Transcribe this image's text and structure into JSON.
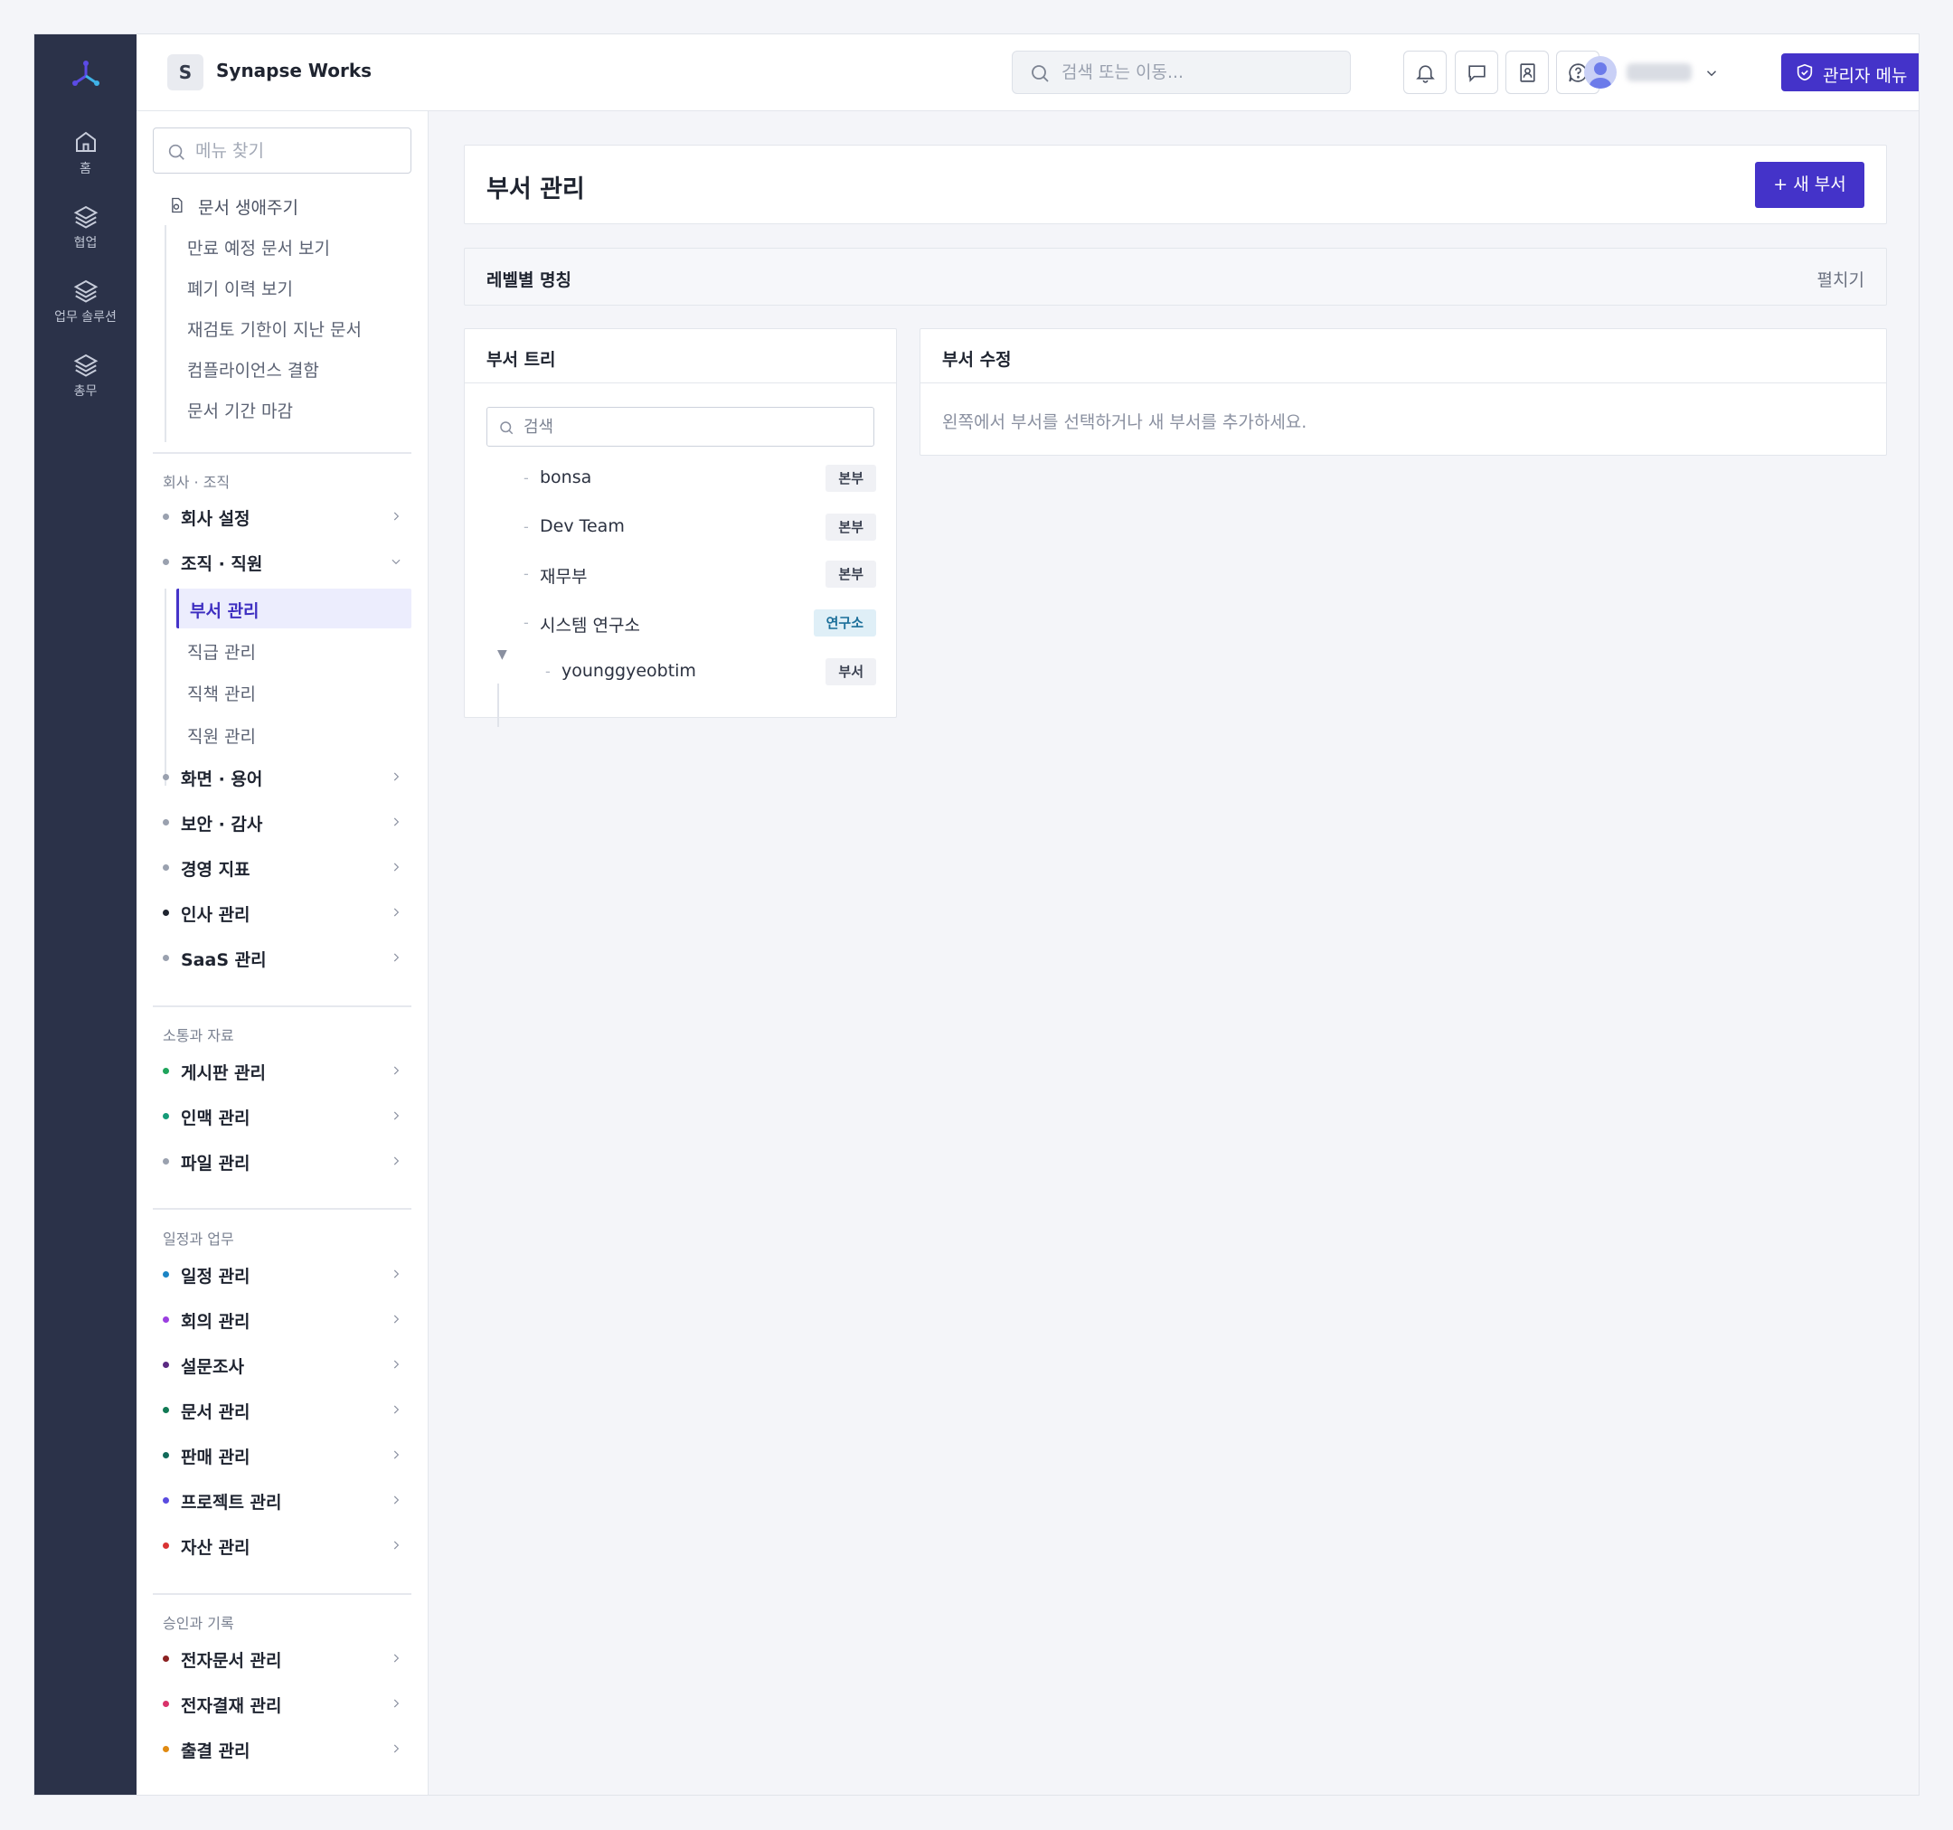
{
  "rail": {
    "items": [
      {
        "label": "홈",
        "icon": "home-icon"
      },
      {
        "label": "협업",
        "icon": "layers-icon"
      },
      {
        "label": "업무 솔루션",
        "icon": "layers-icon"
      },
      {
        "label": "총무",
        "icon": "layers-icon"
      }
    ]
  },
  "topbar": {
    "brand_initial": "S",
    "brand_name": "Synapse Works",
    "search_placeholder": "검색 또는 이동...",
    "admin_label": "관리자 메뉴"
  },
  "sidemenu": {
    "search_placeholder": "메뉴 찾기",
    "lifecycle": {
      "label": "문서 생애주기",
      "items": [
        "만료 예정 문서 보기",
        "폐기 이력 보기",
        "재검토 기한이 지난 문서",
        "컴플라이언스 결함",
        "문서 기간 마감"
      ]
    },
    "sections": [
      {
        "label": "회사 · 조직"
      },
      {
        "label": "소통과 자료"
      },
      {
        "label": "일정과 업무"
      },
      {
        "label": "승인과 기록"
      }
    ],
    "company": [
      {
        "label": "회사 설정",
        "color": "#9aa1af"
      },
      {
        "label": "조직 · 직원",
        "color": "#9aa1af"
      },
      {
        "label": "화면 · 용어",
        "color": "#9aa1af"
      },
      {
        "label": "보안 · 감사",
        "color": "#9aa1af"
      },
      {
        "label": "경영 지표",
        "color": "#9aa1af"
      },
      {
        "label": "인사 관리",
        "color": "#1f2430"
      },
      {
        "label": "SaaS 관리",
        "color": "#9aa1af"
      }
    ],
    "org_sub": {
      "active": "부서 관리",
      "items": [
        "직급 관리",
        "직책 관리",
        "직원 관리"
      ]
    },
    "comm": [
      {
        "label": "게시판 관리",
        "color": "#1fa45c"
      },
      {
        "label": "인맥 관리",
        "color": "#169b78"
      },
      {
        "label": "파일 관리",
        "color": "#9aa1af"
      }
    ],
    "schedule": [
      {
        "label": "일정 관리",
        "color": "#1b84c4"
      },
      {
        "label": "회의 관리",
        "color": "#9b3fe0"
      },
      {
        "label": "설문조사",
        "color": "#5b2a82"
      },
      {
        "label": "문서 관리",
        "color": "#127a55"
      },
      {
        "label": "판매 관리",
        "color": "#126a5a"
      },
      {
        "label": "프로젝트 관리",
        "color": "#5a4be0"
      },
      {
        "label": "자산 관리",
        "color": "#d93333"
      }
    ],
    "approval": [
      {
        "label": "전자문서 관리",
        "color": "#8c2222"
      },
      {
        "label": "전자결재 관리",
        "color": "#d9336a"
      },
      {
        "label": "출결 관리",
        "color": "#e08a12"
      }
    ]
  },
  "main": {
    "title": "부서 관리",
    "new_button": "+ 새 부서",
    "level_title": "레벨별 명칭",
    "level_toggle": "펼치기",
    "tree": {
      "title": "부서 트리",
      "search_placeholder": "검색",
      "nodes": [
        {
          "name": "bonsa",
          "badge": "본부"
        },
        {
          "name": "Dev Team",
          "badge": "본부"
        },
        {
          "name": "재무부",
          "badge": "본부"
        },
        {
          "name": "시스템 연구소",
          "badge": "연구소"
        },
        {
          "name": "younggyeobtim",
          "badge": "부서"
        }
      ]
    },
    "edit": {
      "title": "부서 수정",
      "hint": "왼쪽에서 부서를 선택하거나 새 부서를 추가하세요."
    }
  }
}
